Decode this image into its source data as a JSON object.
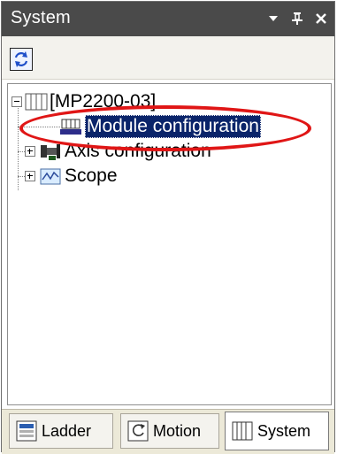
{
  "window": {
    "title": "System",
    "buttons": {
      "dropdown": "▾",
      "pin": "⊥",
      "close": "X"
    }
  },
  "toolbar": {
    "refresh_icon": "refresh-icon"
  },
  "tree": {
    "root": {
      "label": "[MP2200-03]",
      "expanded": true
    },
    "items": [
      {
        "label": "Module configuration",
        "selected": true,
        "icon": "module-icon"
      },
      {
        "label": "Axis configuration",
        "selected": false,
        "icon": "axis-icon",
        "expandable": true
      },
      {
        "label": "Scope",
        "selected": false,
        "icon": "scope-icon",
        "expandable": true
      }
    ]
  },
  "tabs": [
    {
      "label": "Ladder",
      "icon": "ladder-icon",
      "active": false
    },
    {
      "label": "Motion",
      "icon": "motion-icon",
      "active": false
    },
    {
      "label": "System",
      "icon": "system-icon",
      "active": true
    }
  ],
  "colors": {
    "titlebar": "#4a4a4a",
    "selection": "#0a246a",
    "highlight": "#e01616"
  }
}
